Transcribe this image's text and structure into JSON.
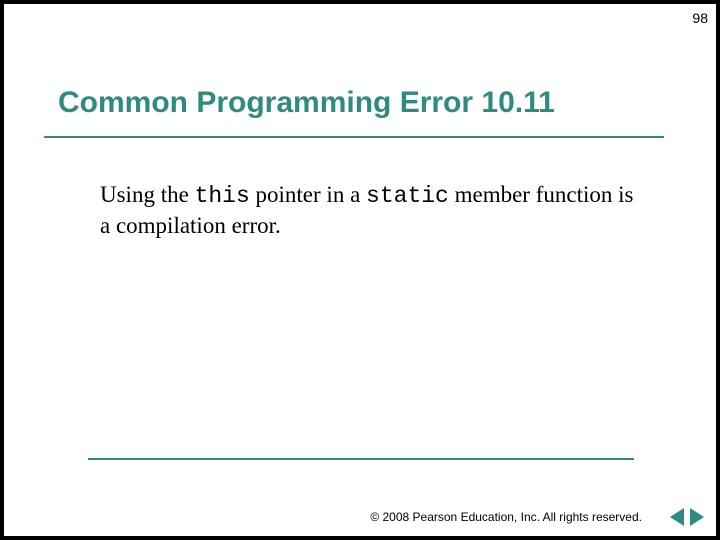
{
  "page_number": "98",
  "title": "Common Programming Error 10.11",
  "body": {
    "t1": "Using the ",
    "kw1": "this",
    "t2": " pointer in a ",
    "kw2": "static",
    "t3": " member function is a compilation error."
  },
  "copyright": "© 2008 Pearson Education, Inc.  All rights reserved.",
  "nav": {
    "prev_name": "prev-slide-button",
    "next_name": "next-slide-button"
  }
}
